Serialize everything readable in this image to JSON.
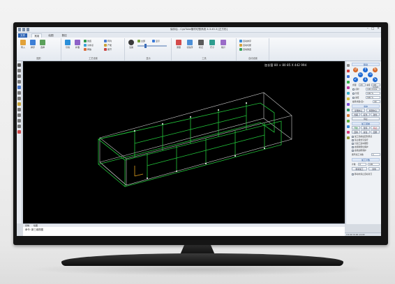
{
  "app": {
    "title": "保存后 - CypTube管材切割系统 4.3.45.3 [正方形]",
    "window_controls": [
      "–",
      "□",
      "✕"
    ]
  },
  "tabs": [
    "文件",
    "常用",
    "绘图",
    "数控"
  ],
  "ribbon": {
    "groups": [
      {
        "label": "图形",
        "buttons": [
          "导入",
          "排序",
          "选择"
        ]
      },
      {
        "label": "工艺设置",
        "buttons": [
          "引线",
          "补偿",
          "微连",
          "冷却点",
          "释放",
          "阵列",
          "产能",
          "断开"
        ]
      },
      {
        "label": "显示",
        "buttons": [
          "渲染",
          "全部",
          "显示"
        ]
      },
      {
        "label": "工具",
        "buttons": [
          "测量",
          "切割序",
          "标记",
          "尺寸",
          "统计"
        ]
      },
      {
        "label": "自动设置",
        "buttons": [
          "自动排序",
          "自动切断",
          "自动微连"
        ]
      }
    ]
  },
  "viewport": {
    "readout": "加长管 80 × 80 85 X 442 994"
  },
  "right_panel": {
    "section_move": "移动",
    "step_label": "步距",
    "step_value": "20",
    "speed_label": "速度",
    "speed_value": "100 mm/s",
    "rows": [
      {
        "label": "点射",
        "value": "100 mm/s"
      },
      {
        "label": "长度",
        "value": "100 %"
      },
      {
        "label": "速度",
        "value": "500 %"
      }
    ],
    "rotate_label": "旋转步距(度):",
    "rotate_value": "90",
    "section_center": "寻中",
    "center_buttons": [
      "寻找中心",
      "找管中心"
    ],
    "ops": [
      "光闸",
      "红光",
      "激光",
      "停止"
    ],
    "section_process": "加工控制",
    "process_buttons": [
      "开始",
      "暂停",
      "停止",
      "回零",
      "复位",
      "回原"
    ],
    "options": [
      "加工完成后回到原点",
      "禁止模式空运行",
      "只加工选中图形",
      "启用软限位保护",
      "启用边框保护"
    ],
    "repeat_label": "循环加工次数",
    "repeat_value": "1",
    "section_count": "加工计数",
    "count_label": "计数",
    "count_value": "0",
    "count_target": "100",
    "count_buttons": [
      "重新加工",
      "清零"
    ],
    "footer_option": "移动时禁止自动对刀"
  },
  "bottom_tabs": [
    "系统",
    "绘图"
  ],
  "command": {
    "prompt": "命令:",
    "value": "新三维视图"
  },
  "status_text": "X:0.00 Y:0.00 A:0.00",
  "colors": {
    "accent": "#2b62b4",
    "mesh": "#22c43a",
    "frame": "#cfcfcf",
    "background": "#000000"
  }
}
